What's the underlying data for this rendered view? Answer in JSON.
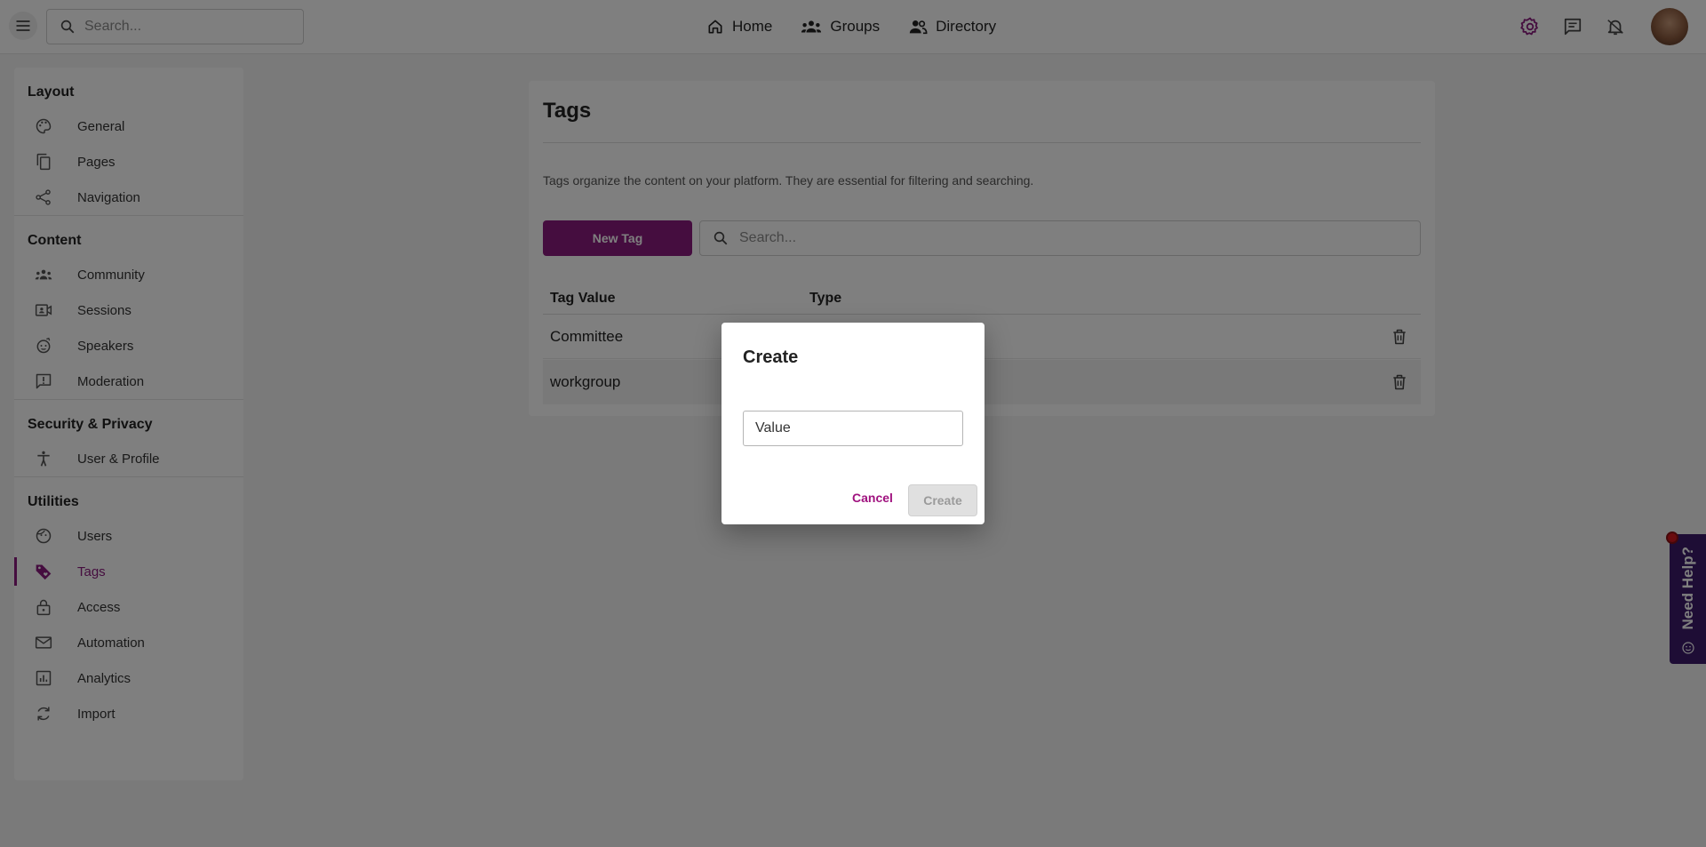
{
  "topbar": {
    "search_placeholder": "Search...",
    "nav": [
      {
        "label": "Home",
        "icon": "home-icon"
      },
      {
        "label": "Groups",
        "icon": "groups-icon"
      },
      {
        "label": "Directory",
        "icon": "directory-icon"
      }
    ],
    "accent_color": "#8b1a7e"
  },
  "sidebar": {
    "sections": [
      {
        "title": "Layout",
        "items": [
          {
            "label": "General",
            "icon": "palette-icon"
          },
          {
            "label": "Pages",
            "icon": "pages-icon"
          },
          {
            "label": "Navigation",
            "icon": "share-icon"
          }
        ]
      },
      {
        "title": "Content",
        "items": [
          {
            "label": "Community",
            "icon": "community-icon"
          },
          {
            "label": "Sessions",
            "icon": "video-icon"
          },
          {
            "label": "Speakers",
            "icon": "speaker-icon"
          },
          {
            "label": "Moderation",
            "icon": "report-icon"
          }
        ]
      },
      {
        "title": "Security & Privacy",
        "items": [
          {
            "label": "User & Profile",
            "icon": "accessibility-icon"
          }
        ]
      },
      {
        "title": "Utilities",
        "items": [
          {
            "label": "Users",
            "icon": "face-icon"
          },
          {
            "label": "Tags",
            "icon": "tag-icon",
            "active": true
          },
          {
            "label": "Access",
            "icon": "lock-icon"
          },
          {
            "label": "Automation",
            "icon": "mail-icon"
          },
          {
            "label": "Analytics",
            "icon": "analytics-icon"
          },
          {
            "label": "Import",
            "icon": "sync-icon"
          }
        ]
      }
    ]
  },
  "main": {
    "title": "Tags",
    "description": "Tags organize the content on your platform. They are essential for filtering and searching.",
    "new_tag_label": "New Tag",
    "search_placeholder": "Search...",
    "table": {
      "headers": [
        "Tag Value",
        "Type"
      ],
      "rows": [
        {
          "value": "Committee",
          "type": ""
        },
        {
          "value": "workgroup",
          "type": ""
        }
      ]
    }
  },
  "help": {
    "label": "Need Help?"
  },
  "dialog": {
    "title": "Create",
    "input_placeholder": "Value",
    "cancel_label": "Cancel",
    "create_label": "Create"
  }
}
